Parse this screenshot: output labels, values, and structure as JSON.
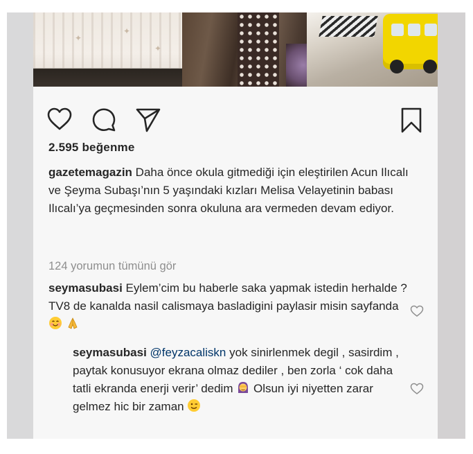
{
  "post": {
    "likes_text": "2.595 beğenme",
    "caption": {
      "username": "gazetemagazin",
      "text": "Daha önce okula gitmediği için eleştirilen Acun Ilıcalı ve Şeyma Subaşı’nın 5 yaşındaki kızları Melisa Velayetinin babası Ilıcalı’ya geçmesinden sonra okuluna ara vermeden devam ediyor."
    },
    "view_all_comments": "124 yorumun tümünü gör"
  },
  "comments": [
    {
      "username": "seymasubasi",
      "text": "Eylem’cim bu haberle saka yapmak istedin herhalde ? TV8 de kanalda nasil calismaya basladigini paylasir misin sayfanda"
    }
  ],
  "reply": {
    "username": "seymasubasi",
    "mention": "@feyzacaliskn",
    "text_1": "yok sinirlenmek degil , sasirdim , paytak konusuyor ekrana olmaz dediler , ben zorla ‘ cok daha tatli ekranda enerji verir’ dedim",
    "text_2": "Olsun iyi niyetten zarar gelmez hic bir zaman"
  },
  "icons": {
    "like": "heart-icon",
    "comment": "comment-bubble-icon",
    "share": "paper-plane-icon",
    "save": "bookmark-icon",
    "comment_like": "small-heart-icon",
    "emoji_1": "smiling-face-emoji",
    "emoji_2": "folded-hands-emoji",
    "emoji_3": "woman-facepalming-emoji",
    "emoji_4": "winking-face-emoji"
  },
  "colors": {
    "text": "#262626",
    "muted": "#8e8e8e",
    "mention": "#003569",
    "background": "#f7f7f7"
  }
}
